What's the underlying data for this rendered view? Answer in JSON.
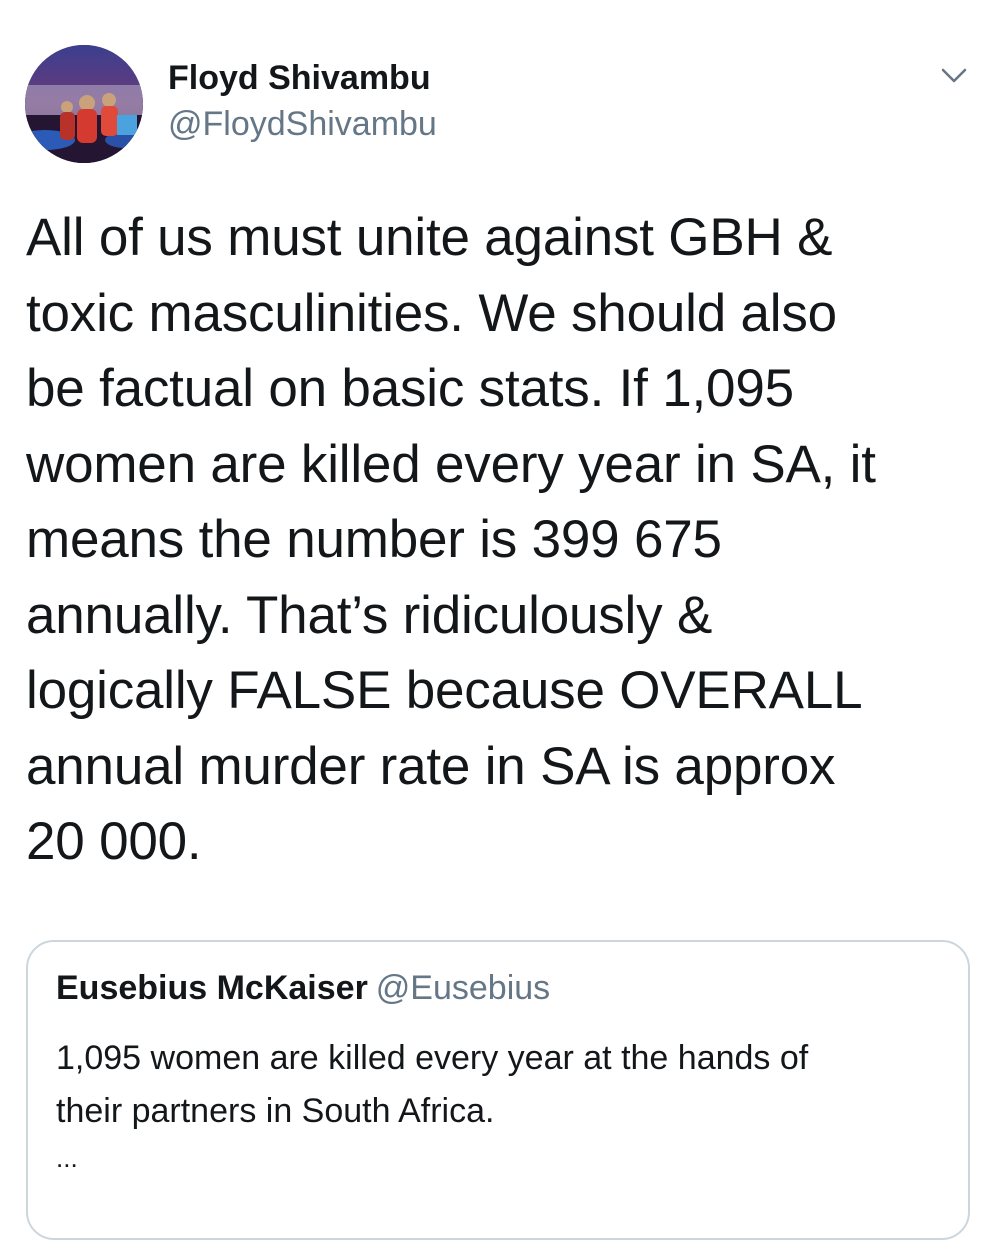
{
  "author": {
    "display_name": "Floyd Shivambu",
    "handle": "@FloydShivambu",
    "avatar_icon": "profile-photo-avatar"
  },
  "tweet": {
    "text_lines": [
      "All of us must unite against GBH &",
      "toxic masculinities. We should also",
      "be factual on basic stats. If 1,095",
      "women are killed every year in SA, it",
      "means the number is 399 675",
      "annually. That’s ridiculously &",
      "logically FALSE because OVERALL",
      "annual murder rate in SA is approx",
      "20 000."
    ]
  },
  "quoted_tweet": {
    "display_name": "Eusebius McKaiser",
    "handle": "@Eusebius",
    "text_lines": [
      "1,095 women are killed every year at the hands of",
      "their partners in South Africa."
    ],
    "ellipsis": "..."
  },
  "icons": {
    "menu": "chevron-down-icon"
  },
  "colors": {
    "text_primary": "#14171a",
    "text_secondary": "#657786",
    "border": "#ccd6dd",
    "background": "#ffffff"
  }
}
